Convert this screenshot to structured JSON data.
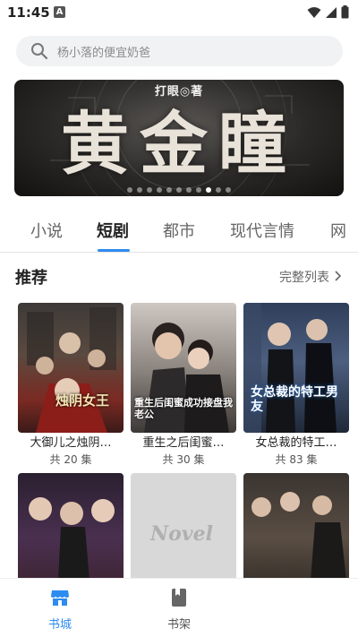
{
  "status_bar": {
    "time": "11:45",
    "notification_letter": "A"
  },
  "search": {
    "placeholder": "杨小落的便宜奶爸"
  },
  "banner": {
    "subtitle": "打眼◎著",
    "title": "黄金瞳",
    "dots_total": 11,
    "active_dot": 8
  },
  "tabs": [
    {
      "label": "小说",
      "active": false
    },
    {
      "label": "短剧",
      "active": true
    },
    {
      "label": "都市",
      "active": false
    },
    {
      "label": "现代言情",
      "active": false
    },
    {
      "label": "网",
      "active": false
    }
  ],
  "section": {
    "title": "推荐",
    "more_label": "完整列表"
  },
  "books": [
    {
      "title": "大御儿之烛阴…",
      "count": "共 20 集",
      "cover_text": "烛阴女王"
    },
    {
      "title": "重生之后闺蜜…",
      "count": "共 30 集",
      "cover_text": "重生后闺蜜成功接盘我老公"
    },
    {
      "title": "女总裁的特工…",
      "count": "共 83 集",
      "cover_text": "女总裁的特工男友"
    },
    {
      "title": "",
      "count": "",
      "cover_text": ""
    },
    {
      "title": "",
      "count": "",
      "cover_text": "Novel"
    },
    {
      "title": "",
      "count": "",
      "cover_text": ""
    }
  ],
  "bottom_nav": {
    "items": [
      {
        "label": "书城",
        "icon": "store-icon",
        "active": true
      },
      {
        "label": "书架",
        "icon": "bookshelf-icon",
        "active": false
      }
    ]
  },
  "colors": {
    "accent": "#2d8cf0",
    "text_primary": "#222222",
    "text_secondary": "#666666"
  }
}
